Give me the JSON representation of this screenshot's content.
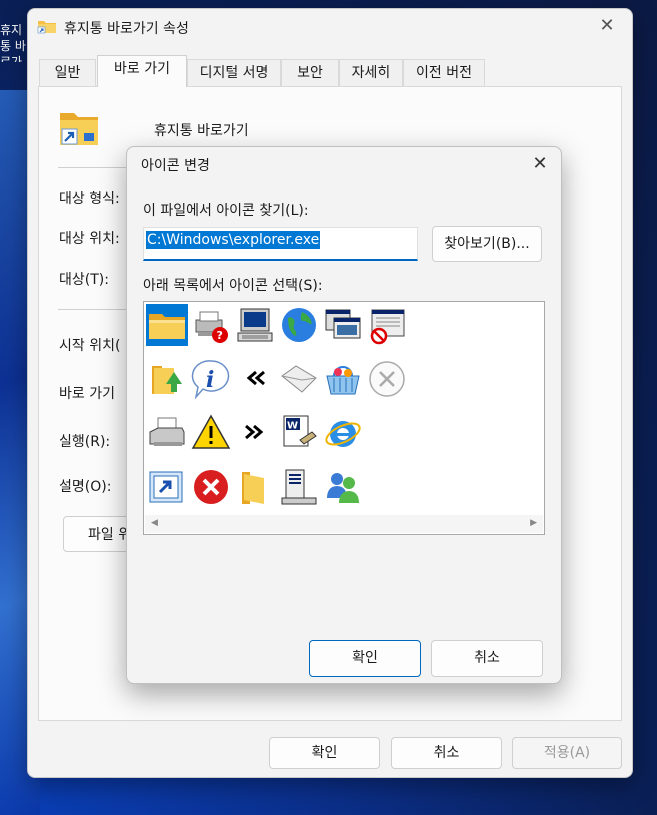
{
  "desktop": {
    "icon_label": "휴지통 바로가기"
  },
  "window": {
    "title": "휴지통 바로가기 속성",
    "tabs": [
      "일반",
      "바로 가기",
      "디지털 서명",
      "보안",
      "자세히",
      "이전 버전"
    ],
    "active_tab": "바로 가기",
    "shortcut_name": "휴지통 바로가기",
    "labels": {
      "target_type": "대상 형식:",
      "target_location": "대상 위치:",
      "target": "대상(T):",
      "start_in": "시작 위치(",
      "shortcut_key": "바로 가기",
      "run": "실행(R):",
      "comment": "설명(O):"
    },
    "open_file_location": "파일 위",
    "buttons": {
      "ok": "확인",
      "cancel": "취소",
      "apply": "적용(A)"
    }
  },
  "dialog": {
    "title": "아이콘 변경",
    "find_label": "이 파일에서 아이콘 찾기(L):",
    "path_value": "C:\\Windows\\explorer.exe",
    "browse": "찾아보기(B)...",
    "select_label": "아래 목록에서 아이콘 선택(S):",
    "icons": [
      "folder-icon",
      "printer-help-icon",
      "computer-icon",
      "globe-icon",
      "windows-cascade-icon",
      "document-blocked-icon",
      "folder-up-icon",
      "info-icon",
      "rewind-icon",
      "envelope-icon",
      "shopping-basket-icon",
      "close-circle-icon",
      "printer-icon",
      "warning-icon",
      "fast-forward-icon",
      "wordpad-document-icon",
      "internet-explorer-icon",
      "shortcut-arrow-icon",
      "error-icon",
      "open-folder-icon",
      "server-icon",
      "users-icon"
    ],
    "selected_icon": "folder-icon",
    "buttons": {
      "ok": "확인",
      "cancel": "취소"
    }
  },
  "colors": {
    "accent": "#0078d4",
    "focus_border": "#0067c0",
    "folder": "#f4c146"
  }
}
